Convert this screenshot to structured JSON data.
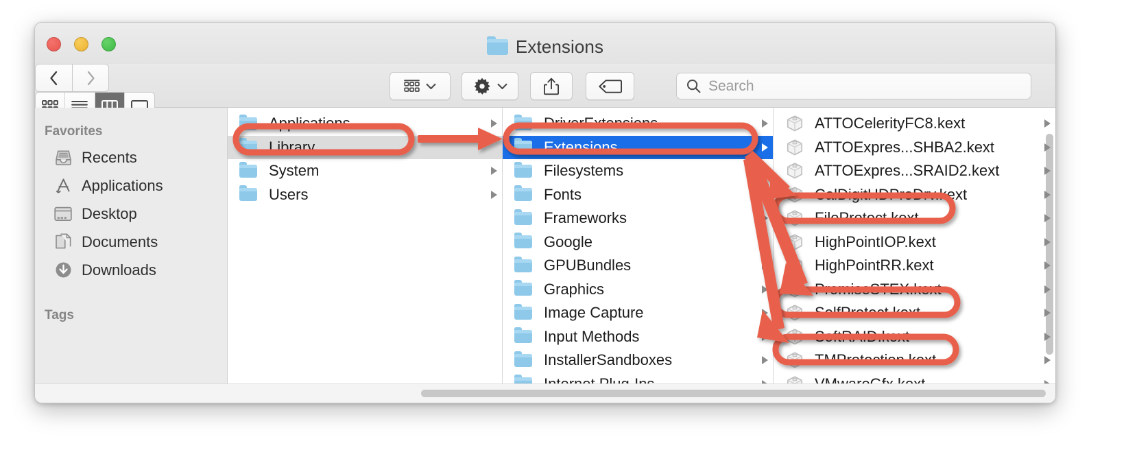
{
  "window": {
    "title": "Extensions",
    "title_icon": "folder-icon",
    "traffic_lights": [
      "close-button",
      "minimize-button",
      "zoom-button"
    ]
  },
  "toolbar": {
    "back_label": "Back",
    "forward_label": "Forward",
    "view_modes": [
      {
        "name": "icon-view",
        "label": "Icon View",
        "selected": false
      },
      {
        "name": "list-view",
        "label": "List View",
        "selected": false
      },
      {
        "name": "column-view",
        "label": "Column View",
        "selected": true
      },
      {
        "name": "gallery-view",
        "label": "Gallery View",
        "selected": false
      }
    ],
    "group_label": "Group items",
    "action_label": "Action",
    "share_label": "Share",
    "tag_label": "Edit Tags"
  },
  "search": {
    "placeholder": "Search",
    "value": "",
    "icon": "search-icon"
  },
  "sidebar": {
    "sections": [
      {
        "header": "Favorites",
        "items": [
          {
            "label": "Recents",
            "icon": "recents-icon"
          },
          {
            "label": "Applications",
            "icon": "applications-icon"
          },
          {
            "label": "Desktop",
            "icon": "desktop-icon"
          },
          {
            "label": "Documents",
            "icon": "documents-icon"
          },
          {
            "label": "Downloads",
            "icon": "downloads-icon"
          }
        ]
      },
      {
        "header": "Tags",
        "items": []
      }
    ]
  },
  "columns": [
    {
      "name": "column-1",
      "items": [
        {
          "label": "Applications",
          "icon": "folder-appstore-icon",
          "disclosure": true,
          "selected": "none"
        },
        {
          "label": "Library",
          "icon": "folder-library-icon",
          "disclosure": false,
          "selected": "inactive"
        },
        {
          "label": "System",
          "icon": "folder-system-icon",
          "disclosure": true,
          "selected": "none"
        },
        {
          "label": "Users",
          "icon": "folder-users-icon",
          "disclosure": true,
          "selected": "none"
        }
      ]
    },
    {
      "name": "column-2",
      "items": [
        {
          "label": "DriverExtensions",
          "icon": "folder-icon",
          "disclosure": true,
          "selected": "none"
        },
        {
          "label": "Extensions",
          "icon": "folder-icon",
          "disclosure": true,
          "selected": "active"
        },
        {
          "label": "Filesystems",
          "icon": "folder-icon",
          "disclosure": false,
          "selected": "none"
        },
        {
          "label": "Fonts",
          "icon": "folder-icon",
          "disclosure": false,
          "selected": "none"
        },
        {
          "label": "Frameworks",
          "icon": "folder-icon",
          "disclosure": true,
          "selected": "none"
        },
        {
          "label": "Google",
          "icon": "folder-icon",
          "disclosure": true,
          "selected": "none"
        },
        {
          "label": "GPUBundles",
          "icon": "folder-icon",
          "disclosure": true,
          "selected": "none"
        },
        {
          "label": "Graphics",
          "icon": "folder-icon",
          "disclosure": true,
          "selected": "none"
        },
        {
          "label": "Image Capture",
          "icon": "folder-icon",
          "disclosure": true,
          "selected": "none"
        },
        {
          "label": "Input Methods",
          "icon": "folder-icon",
          "disclosure": true,
          "selected": "none"
        },
        {
          "label": "InstallerSandboxes",
          "icon": "folder-icon",
          "disclosure": true,
          "selected": "none"
        },
        {
          "label": "Internet Plug-Ins",
          "icon": "folder-icon",
          "disclosure": true,
          "selected": "none"
        }
      ]
    },
    {
      "name": "column-3",
      "items": [
        {
          "label": "ATTOCelerityFC8.kext",
          "icon": "kext-icon",
          "disclosure": true,
          "selected": "none",
          "highlighted": false
        },
        {
          "label": "ATTOExpres...SHBA2.kext",
          "icon": "kext-icon",
          "disclosure": true,
          "selected": "none",
          "highlighted": false
        },
        {
          "label": "ATTOExpres...SRAID2.kext",
          "icon": "kext-icon",
          "disclosure": true,
          "selected": "none",
          "highlighted": false
        },
        {
          "label": "CalDigitHDProDrv.kext",
          "icon": "kext-icon",
          "disclosure": true,
          "selected": "none",
          "highlighted": false
        },
        {
          "label": "FileProtect.kext",
          "icon": "kext-icon",
          "disclosure": true,
          "selected": "none",
          "highlighted": true
        },
        {
          "label": "HighPointIOP.kext",
          "icon": "kext-icon",
          "disclosure": true,
          "selected": "none",
          "highlighted": false
        },
        {
          "label": "HighPointRR.kext",
          "icon": "kext-icon",
          "disclosure": true,
          "selected": "none",
          "highlighted": false
        },
        {
          "label": "PromiseSTEX.kext",
          "icon": "kext-icon",
          "disclosure": true,
          "selected": "none",
          "highlighted": false
        },
        {
          "label": "SelfProtect.kext",
          "icon": "kext-icon",
          "disclosure": true,
          "selected": "none",
          "highlighted": true
        },
        {
          "label": "SoftRAID.kext",
          "icon": "kext-icon",
          "disclosure": true,
          "selected": "none",
          "highlighted": false
        },
        {
          "label": "TMProtection.kext",
          "icon": "kext-icon",
          "disclosure": true,
          "selected": "none",
          "highlighted": true
        },
        {
          "label": "VMwareGfx.kext",
          "icon": "kext-icon",
          "disclosure": true,
          "selected": "none",
          "highlighted": false
        }
      ]
    }
  ],
  "annotations": {
    "color": "#e8604c",
    "ellipses": [
      {
        "target": "Library",
        "name": "annotation-ellipse-library"
      },
      {
        "target": "Extensions",
        "name": "annotation-ellipse-extensions"
      },
      {
        "target": "FileProtect.kext",
        "name": "annotation-ellipse-fileprotect"
      },
      {
        "target": "SelfProtect.kext",
        "name": "annotation-ellipse-selfprotect"
      },
      {
        "target": "TMProtection.kext",
        "name": "annotation-ellipse-tmprotection"
      }
    ],
    "arrows": [
      {
        "from": "Library",
        "to": "Extensions",
        "name": "annotation-arrow-library-to-extensions"
      },
      {
        "from": "Extensions",
        "to": "FileProtect.kext",
        "name": "annotation-arrow-to-fileprotect"
      },
      {
        "from": "Extensions",
        "to": "SelfProtect.kext",
        "name": "annotation-arrow-to-selfprotect"
      },
      {
        "from": "Extensions",
        "to": "TMProtection.kext",
        "name": "annotation-arrow-to-tmprotection"
      }
    ]
  }
}
